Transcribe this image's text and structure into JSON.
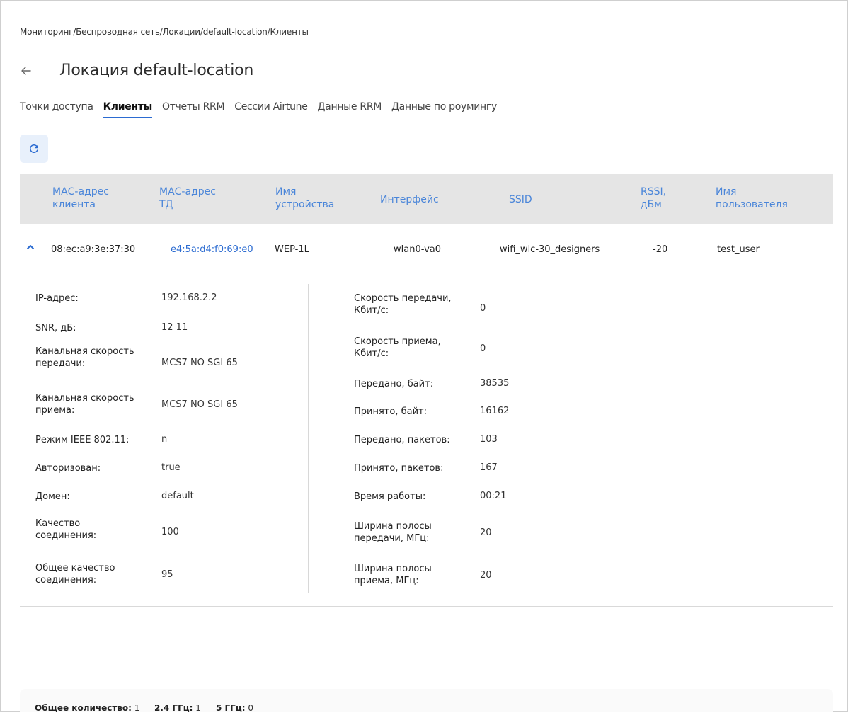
{
  "breadcrumb": "Мониторинг/Беспроводная сеть/Локации/default-location/Клиенты",
  "title": "Локация default-location",
  "tabs": [
    {
      "label": "Точки доступа",
      "active": false
    },
    {
      "label": "Клиенты",
      "active": true
    },
    {
      "label": "Отчеты RRM",
      "active": false
    },
    {
      "label": "Сессии Airtune",
      "active": false
    },
    {
      "label": "Данные RRM",
      "active": false
    },
    {
      "label": "Данные по роумингу",
      "active": false
    }
  ],
  "table": {
    "headers": {
      "mac_client_1": "МАС-адрес",
      "mac_client_2": "клиента",
      "mac_ap_1": "МАС-адрес",
      "mac_ap_2": "ТД",
      "device_1": "Имя",
      "device_2": "устройства",
      "interface": "Интерфейс",
      "ssid": "SSID",
      "rssi_1": "RSSI,",
      "rssi_2": "дБм",
      "user_1": "Имя",
      "user_2": "пользователя"
    },
    "row": {
      "mac_client": "08:ec:a9:3e:37:30",
      "mac_ap": "e4:5a:d4:f0:69:e0",
      "device": "WEP-1L",
      "interface": "wlan0-va0",
      "ssid": "wifi_wlc-30_designers",
      "rssi": "-20",
      "user": "test_user"
    }
  },
  "details": {
    "left": [
      {
        "label_1": "IP-адрес:",
        "label_2": "",
        "value": "192.168.2.2"
      },
      {
        "label_1": "SNR, дБ:",
        "label_2": "",
        "value": "12 11"
      },
      {
        "label_1": "Канальная скорость",
        "label_2": "передачи:",
        "value": "MCS7 NO SGI 65"
      },
      {
        "label_1": "Канальная скорость",
        "label_2": "приема:",
        "value": "MCS7 NO SGI 65"
      },
      {
        "label_1": "Режим IEEE 802.11:",
        "label_2": "",
        "value": "n"
      },
      {
        "label_1": "Авторизован:",
        "label_2": "",
        "value": "true"
      },
      {
        "label_1": "Домен:",
        "label_2": "",
        "value": "default"
      },
      {
        "label_1": "Качество",
        "label_2": "соединения:",
        "value": "100"
      },
      {
        "label_1": "Общее качество",
        "label_2": "соединения:",
        "value": "95"
      }
    ],
    "right": [
      {
        "label_1": "Скорость передачи,",
        "label_2": "Кбит/с:",
        "value": "0"
      },
      {
        "label_1": "Скорость приема,",
        "label_2": "Кбит/с:",
        "value": "0"
      },
      {
        "label_1": "Передано, байт:",
        "label_2": "",
        "value": "38535"
      },
      {
        "label_1": "Принято, байт:",
        "label_2": "",
        "value": "16162"
      },
      {
        "label_1": "Передано, пакетов:",
        "label_2": "",
        "value": "103"
      },
      {
        "label_1": "Принято, пакетов:",
        "label_2": "",
        "value": "167"
      },
      {
        "label_1": "Время работы:",
        "label_2": "",
        "value": "00:21"
      },
      {
        "label_1": "Ширина полосы",
        "label_2": "передачи, МГц:",
        "value": "20"
      },
      {
        "label_1": "Ширина полосы",
        "label_2": "приема, МГц:",
        "value": "20"
      }
    ]
  },
  "footer": {
    "total_label": "Общее количество:",
    "total_value": "1",
    "band24_label": "2.4 ГГц:",
    "band24_value": "1",
    "band5_label": "5 ГГц:",
    "band5_value": "0"
  },
  "colors": {
    "accent": "#2b6bd1",
    "header_text": "#4b86d9",
    "header_bg": "#e5e5e5",
    "refresh_bg": "#e8f0fb"
  },
  "icons": {
    "back": "arrow-left-icon",
    "refresh": "refresh-icon",
    "expand": "chevron-up-icon"
  }
}
